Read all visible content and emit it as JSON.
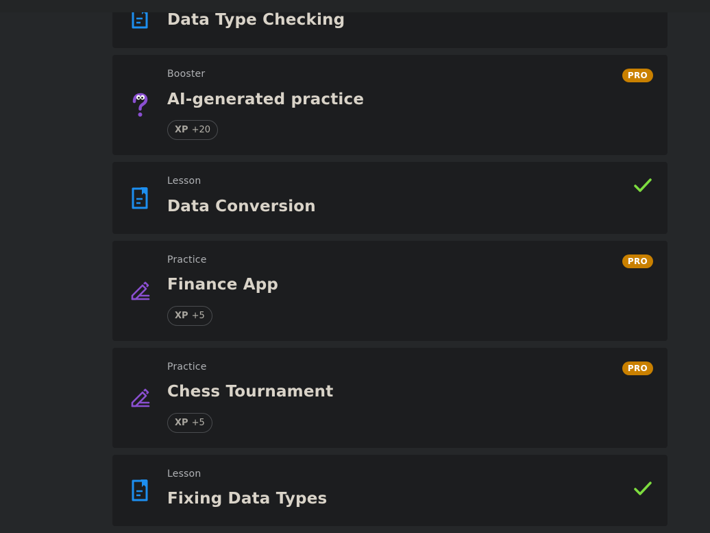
{
  "colors": {
    "background": "#252729",
    "card": "#1c1d1f",
    "lesson_icon": "#1d8ff0",
    "practice_icon": "#8a4fd1",
    "pro_badge": "#c98000",
    "check": "#7ddc3f",
    "title_text": "#d9d3c8"
  },
  "items": [
    {
      "type": "",
      "title": "Data Type Checking",
      "icon": "lesson-icon"
    },
    {
      "type": "Booster",
      "title": "AI-generated practice",
      "icon": "question-mark-icon",
      "xp_label": "XP",
      "xp_value": "+20",
      "badge": "PRO"
    },
    {
      "type": "Lesson",
      "title": "Data Conversion",
      "icon": "lesson-icon",
      "completed": true
    },
    {
      "type": "Practice",
      "title": "Finance App",
      "icon": "pencil-icon",
      "xp_label": "XP",
      "xp_value": "+5",
      "badge": "PRO"
    },
    {
      "type": "Practice",
      "title": "Chess Tournament",
      "icon": "pencil-icon",
      "xp_label": "XP",
      "xp_value": "+5",
      "badge": "PRO"
    },
    {
      "type": "Lesson",
      "title": "Fixing Data Types",
      "icon": "lesson-icon",
      "completed": true
    }
  ]
}
